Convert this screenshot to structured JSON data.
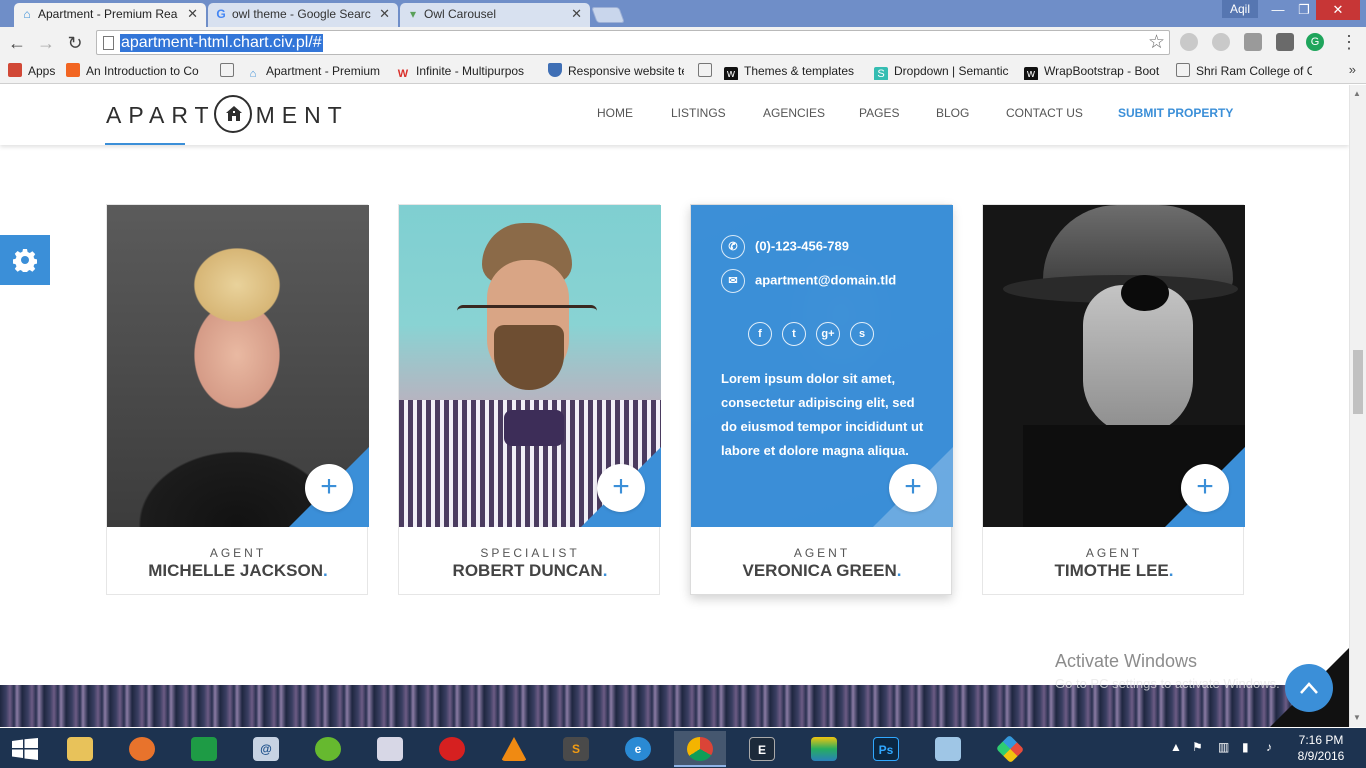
{
  "browser": {
    "tabs": [
      {
        "title": "Apartment - Premium Rea",
        "icon": "house-icon",
        "active": true
      },
      {
        "title": "owl theme - Google Searc",
        "icon": "google-icon",
        "active": false
      },
      {
        "title": "Owl Carousel",
        "icon": "owl-icon",
        "active": false
      }
    ],
    "close_glyph": "✕",
    "user_name": "Aqil",
    "url": "apartment-html.chart.civ.pl/#",
    "bookmarks": [
      {
        "label": "Apps",
        "color": "#d14836"
      },
      {
        "label": "An Introduction to Co",
        "color": "#f26522"
      },
      {
        "label": "",
        "color": "#888888"
      },
      {
        "label": "Apartment - Premium",
        "color": "#3b8fd8"
      },
      {
        "label": "Infinite - Multipurpos",
        "color": "#d9302b"
      },
      {
        "label": "Responsive website te",
        "color": "#3f6fb5"
      },
      {
        "label": "",
        "color": "#888888"
      },
      {
        "label": "Themes & templates",
        "color": "#111111"
      },
      {
        "label": "Dropdown | Semantic",
        "color": "#35bdb2"
      },
      {
        "label": "WrapBootstrap - Boot",
        "color": "#111111"
      },
      {
        "label": "Shri Ram College of C",
        "color": "#888888"
      }
    ]
  },
  "site": {
    "logo_left": "APART",
    "logo_right": "MENT",
    "nav": [
      {
        "label": "HOME"
      },
      {
        "label": "LISTINGS"
      },
      {
        "label": "AGENCIES"
      },
      {
        "label": "PAGES"
      },
      {
        "label": "BLOG"
      },
      {
        "label": "CONTACT US"
      },
      {
        "label": "SUBMIT PROPERTY"
      }
    ],
    "accent_color": "#3b8fd8",
    "agents": [
      {
        "role": "AGENT",
        "name": "MICHELLE JACKSON",
        "dot": "."
      },
      {
        "role": "SPECIALIST",
        "name": "ROBERT DUNCAN",
        "dot": "."
      },
      {
        "role": "AGENT",
        "name": "VERONICA GREEN",
        "dot": "."
      },
      {
        "role": "AGENT",
        "name": "TIMOTHE LEE",
        "dot": "."
      }
    ],
    "featured_contact": {
      "phone": "(0)-123-456-789",
      "email": "apartment@domain.tld",
      "social_icons": [
        "facebook-icon",
        "twitter-icon",
        "google-plus-icon",
        "skype-icon"
      ],
      "bio": "Lorem ipsum dolor sit amet, consectetur adipiscing elit, sed do eiusmod tempor incididunt ut labore et dolore magna aliqua."
    },
    "plus_glyph": "+"
  },
  "overlay": {
    "activate_title": "Activate Windows",
    "activate_sub": "Go to PC settings to activate Windows."
  },
  "taskbar": {
    "apps": [
      "file-explorer-icon",
      "firefox-icon",
      "store-icon",
      "network-icon",
      "lime-icon",
      "paint-icon",
      "opera-icon",
      "vlc-icon",
      "sublime-icon",
      "ie-icon",
      "chrome-icon",
      "eclipse-icon",
      "bluestacks-icon",
      "photoshop-icon",
      "notepad-icon",
      "app-icon"
    ],
    "time": "7:16 PM",
    "date": "8/9/2016"
  }
}
